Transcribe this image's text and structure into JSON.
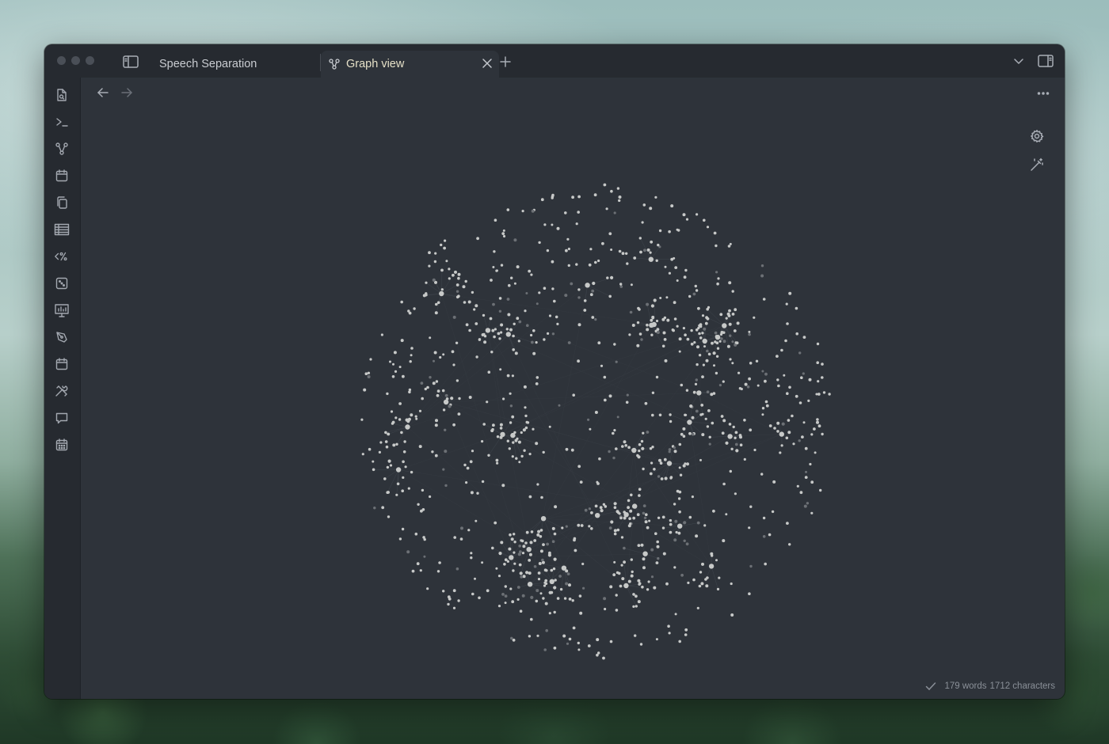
{
  "tabs": [
    {
      "label": "Speech Separation",
      "active": false
    },
    {
      "label": "Graph view",
      "active": true
    }
  ],
  "status": {
    "word_count": "179 words",
    "char_count": "1712 characters"
  },
  "ribbon_icons": [
    "file-search-icon",
    "terminal-icon",
    "graph-icon",
    "calendar-icon",
    "copy-icon",
    "table-icon",
    "templater-icon",
    "dice-icon",
    "presentation-icon",
    "pen-tool-icon",
    "calendar-icon-2",
    "tools-icon",
    "chat-icon",
    "calendar-grid-icon"
  ],
  "colors": {
    "window_bg": "#2e333a",
    "titlebar_bg": "#262a30",
    "accent_text": "#e6e1c8",
    "node": "#c7c9c8",
    "node_dim": "#6c7075"
  }
}
